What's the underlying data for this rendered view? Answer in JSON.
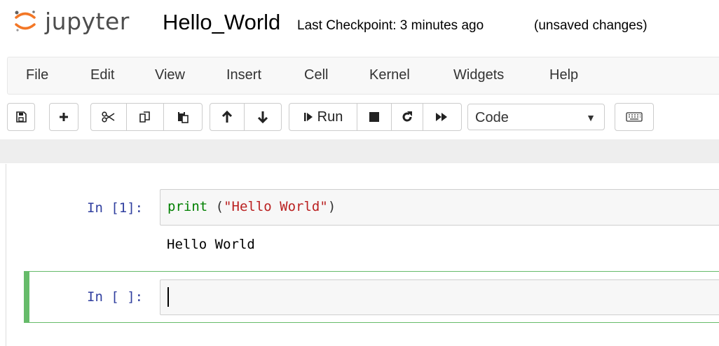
{
  "header": {
    "logo_text": "jupyter",
    "notebook_name": "Hello_World",
    "checkpoint": "Last Checkpoint: 3 minutes ago",
    "status": "(unsaved changes)"
  },
  "menu": [
    "File",
    "Edit",
    "View",
    "Insert",
    "Cell",
    "Kernel",
    "Widgets",
    "Help"
  ],
  "toolbar": {
    "run_label": "Run",
    "cell_type": "Code",
    "icons": [
      "save-icon",
      "plus-icon",
      "cut-icon",
      "copy-icon",
      "paste-icon",
      "arrow-up-icon",
      "arrow-down-icon",
      "step-forward-icon",
      "stop-icon",
      "refresh-icon",
      "fast-forward-icon",
      "keyboard-icon"
    ]
  },
  "cells": [
    {
      "prompt": "In [1]:",
      "code": {
        "keyword": "print",
        "open": " (",
        "string": "\"Hello World\"",
        "close": ")"
      },
      "output": "Hello World"
    },
    {
      "prompt": "In [ ]:",
      "code": ""
    }
  ],
  "colors": {
    "prompt": "#303f9f",
    "keyword": "#008000",
    "string": "#ba2121",
    "selected_border": "#66bb6a"
  }
}
